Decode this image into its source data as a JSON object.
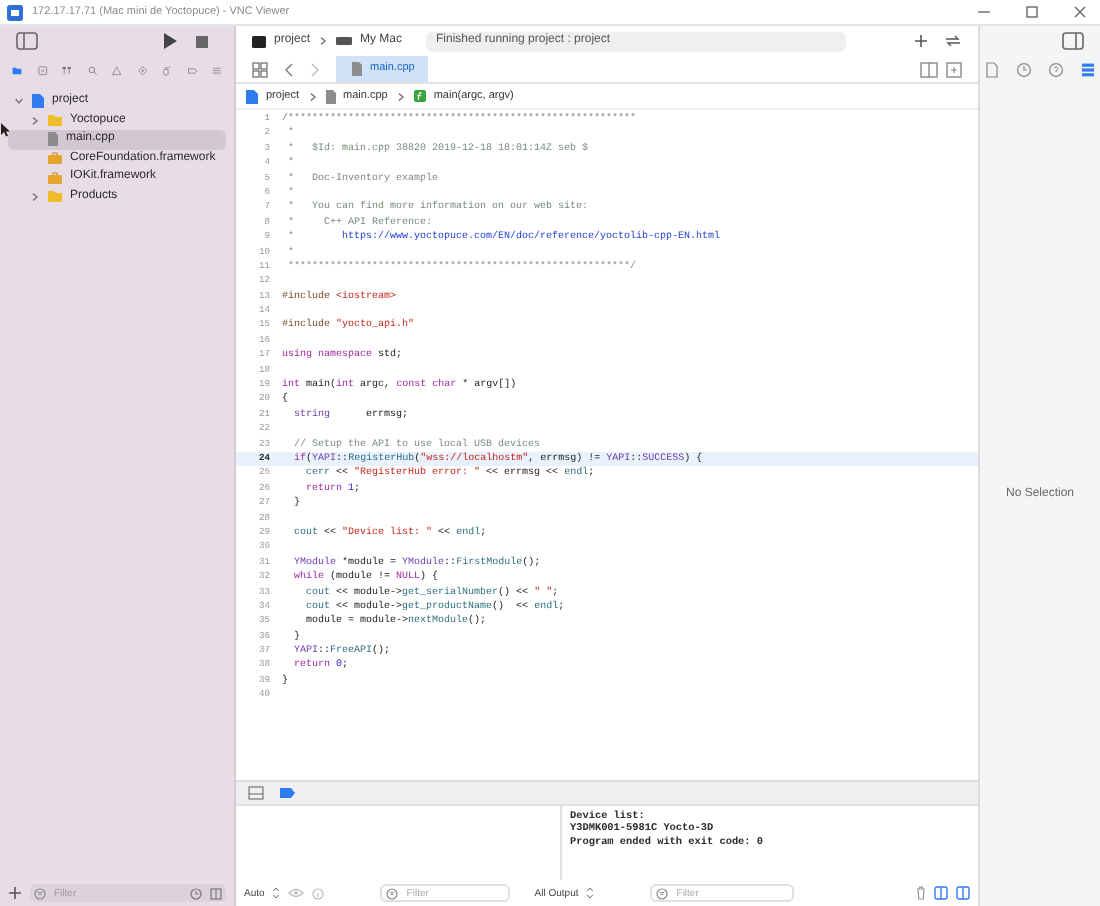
{
  "window": {
    "title": "172.17.17.71 (Mac mini de Yoctopuce) - VNC Viewer"
  },
  "toolbar": {
    "scheme": "project",
    "destination": "My Mac",
    "status": "Finished running project : project"
  },
  "navigator": {
    "tabs": [
      {
        "kind": "files",
        "selected": true
      },
      {
        "kind": "source-control",
        "selected": false
      },
      {
        "kind": "symbols",
        "selected": false
      },
      {
        "kind": "find",
        "selected": false
      },
      {
        "kind": "issues",
        "selected": false
      },
      {
        "kind": "tests",
        "selected": false
      },
      {
        "kind": "debug",
        "selected": false
      },
      {
        "kind": "breakpoints",
        "selected": false
      },
      {
        "kind": "reports",
        "selected": false
      }
    ],
    "tree": [
      {
        "label": "project",
        "kind": "project",
        "expanded": true,
        "selected": false,
        "children": [
          {
            "label": "Yoctopuce",
            "kind": "folder",
            "expanded": false,
            "selected": false
          },
          {
            "label": "main.cpp",
            "kind": "file",
            "selected": true
          },
          {
            "label": "CoreFoundation.framework",
            "kind": "framework",
            "selected": false
          },
          {
            "label": "IOKit.framework",
            "kind": "framework",
            "selected": false
          },
          {
            "label": "Products",
            "kind": "folder",
            "expanded": false,
            "selected": false
          }
        ]
      }
    ],
    "filter_placeholder": "Filter"
  },
  "editor": {
    "tabs": [
      {
        "label": "main.cpp",
        "selected": true
      }
    ],
    "breadcrumb": [
      {
        "label": "project",
        "kind": "project"
      },
      {
        "label": "main.cpp",
        "kind": "file"
      },
      {
        "label": "main(argc, argv)",
        "kind": "function"
      }
    ],
    "lines": [
      {
        "number": "1",
        "current": false,
        "segments": [
          {
            "text": "/**********************************************************",
            "kind": "comment"
          }
        ]
      },
      {
        "number": "2",
        "current": false,
        "segments": [
          {
            "text": " *",
            "kind": "comment"
          }
        ]
      },
      {
        "number": "3",
        "current": false,
        "segments": [
          {
            "text": " *   $Id: main.cpp 38820 2019-12-18 18:01:14Z seb $",
            "kind": "comment"
          }
        ]
      },
      {
        "number": "4",
        "current": false,
        "segments": [
          {
            "text": " *",
            "kind": "comment"
          }
        ]
      },
      {
        "number": "5",
        "current": false,
        "segments": [
          {
            "text": " *   Doc-Inventory example",
            "kind": "comment"
          }
        ]
      },
      {
        "number": "6",
        "current": false,
        "segments": [
          {
            "text": " *",
            "kind": "comment"
          }
        ]
      },
      {
        "number": "7",
        "current": false,
        "segments": [
          {
            "text": " *   You can find more information on our web site:",
            "kind": "comment"
          }
        ]
      },
      {
        "number": "8",
        "current": false,
        "segments": [
          {
            "text": " *     C++ API Reference:",
            "kind": "comment"
          }
        ]
      },
      {
        "number": "9",
        "current": false,
        "segments": [
          {
            "text": " *        ",
            "kind": "comment"
          },
          {
            "text": "https://www.yoctopuce.com/EN/doc/reference/yoctolib-cpp-EN.html",
            "kind": "url"
          }
        ]
      },
      {
        "number": "10",
        "current": false,
        "segments": [
          {
            "text": " *",
            "kind": "comment"
          }
        ]
      },
      {
        "number": "11",
        "current": false,
        "segments": [
          {
            "text": " *********************************************************/",
            "kind": "comment"
          }
        ]
      },
      {
        "number": "12",
        "current": false
      },
      {
        "number": "13",
        "current": false,
        "segments": [
          {
            "text": "#include ",
            "kind": "preproc"
          },
          {
            "text": "<iostream>",
            "kind": "string"
          }
        ]
      },
      {
        "number": "14",
        "current": false
      },
      {
        "number": "15",
        "current": false,
        "segments": [
          {
            "text": "#include ",
            "kind": "preproc"
          },
          {
            "text": "\"yocto_api.h\"",
            "kind": "string"
          }
        ]
      },
      {
        "number": "16",
        "current": false
      },
      {
        "number": "17",
        "current": false,
        "segments": [
          {
            "text": "using namespace",
            "kind": "keyword"
          },
          {
            "text": " std;",
            "kind": "plain"
          }
        ]
      },
      {
        "number": "18",
        "current": false
      },
      {
        "number": "19",
        "current": false,
        "segments": [
          {
            "text": "int",
            "kind": "keyword"
          },
          {
            "text": " main(",
            "kind": "plain"
          },
          {
            "text": "int",
            "kind": "keyword"
          },
          {
            "text": " argc, ",
            "kind": "plain"
          },
          {
            "text": "const char",
            "kind": "keyword"
          },
          {
            "text": " * argv[])",
            "kind": "plain"
          }
        ]
      },
      {
        "number": "20",
        "current": false,
        "segments": [
          {
            "text": "{",
            "kind": "plain"
          }
        ]
      },
      {
        "number": "21",
        "current": false,
        "segments": [
          {
            "text": "  string",
            "kind": "type"
          },
          {
            "text": "      errmsg;",
            "kind": "plain"
          }
        ]
      },
      {
        "number": "22",
        "current": false
      },
      {
        "number": "23",
        "current": false,
        "segments": [
          {
            "text": "  // Setup the API to use local USB devices",
            "kind": "comment"
          }
        ]
      },
      {
        "number": "24",
        "current": true,
        "segments": [
          {
            "text": "  if",
            "kind": "keyword"
          },
          {
            "text": "(",
            "kind": "plain"
          },
          {
            "text": "YAPI",
            "kind": "type"
          },
          {
            "text": "::",
            "kind": "plain"
          },
          {
            "text": "RegisterHub",
            "kind": "call"
          },
          {
            "text": "(",
            "kind": "plain"
          },
          {
            "text": "\"wss://localhostm\"",
            "kind": "string"
          },
          {
            "text": ", errmsg) != ",
            "kind": "plain"
          },
          {
            "text": "YAPI",
            "kind": "type"
          },
          {
            "text": "::",
            "kind": "plain"
          },
          {
            "text": "SUCCESS",
            "kind": "type"
          },
          {
            "text": ") {",
            "kind": "plain"
          }
        ]
      },
      {
        "number": "25",
        "current": false,
        "segments": [
          {
            "text": "    cerr",
            "kind": "call"
          },
          {
            "text": " << ",
            "kind": "plain"
          },
          {
            "text": "\"RegisterHub error: \"",
            "kind": "string"
          },
          {
            "text": " << errmsg << ",
            "kind": "plain"
          },
          {
            "text": "endl",
            "kind": "call"
          },
          {
            "text": ";",
            "kind": "plain"
          }
        ]
      },
      {
        "number": "26",
        "current": false,
        "segments": [
          {
            "text": "    return ",
            "kind": "keyword"
          },
          {
            "text": "1",
            "kind": "number"
          },
          {
            "text": ";",
            "kind": "plain"
          }
        ]
      },
      {
        "number": "27",
        "current": false,
        "segments": [
          {
            "text": "  }",
            "kind": "plain"
          }
        ]
      },
      {
        "number": "28",
        "current": false
      },
      {
        "number": "29",
        "current": false,
        "segments": [
          {
            "text": "  cout",
            "kind": "call"
          },
          {
            "text": " << ",
            "kind": "plain"
          },
          {
            "text": "\"Device list: \"",
            "kind": "string"
          },
          {
            "text": " << ",
            "kind": "plain"
          },
          {
            "text": "endl",
            "kind": "call"
          },
          {
            "text": ";",
            "kind": "plain"
          }
        ]
      },
      {
        "number": "30",
        "current": false
      },
      {
        "number": "31",
        "current": false,
        "segments": [
          {
            "text": "  YModule",
            "kind": "type"
          },
          {
            "text": " *module = ",
            "kind": "plain"
          },
          {
            "text": "YModule",
            "kind": "type"
          },
          {
            "text": "::",
            "kind": "plain"
          },
          {
            "text": "FirstModule",
            "kind": "call"
          },
          {
            "text": "();",
            "kind": "plain"
          }
        ]
      },
      {
        "number": "32",
        "current": false,
        "segments": [
          {
            "text": "  while",
            "kind": "keyword"
          },
          {
            "text": " (module != ",
            "kind": "plain"
          },
          {
            "text": "NULL",
            "kind": "keyword"
          },
          {
            "text": ") {",
            "kind": "plain"
          }
        ]
      },
      {
        "number": "33",
        "current": false,
        "segments": [
          {
            "text": "    cout",
            "kind": "call"
          },
          {
            "text": " << module->",
            "kind": "plain"
          },
          {
            "text": "get_serialNumber",
            "kind": "call"
          },
          {
            "text": "() << ",
            "kind": "plain"
          },
          {
            "text": "\" \"",
            "kind": "string"
          },
          {
            "text": ";",
            "kind": "plain"
          }
        ]
      },
      {
        "number": "34",
        "current": false,
        "segments": [
          {
            "text": "    cout",
            "kind": "call"
          },
          {
            "text": " << module->",
            "kind": "plain"
          },
          {
            "text": "get_productName",
            "kind": "call"
          },
          {
            "text": "()  << ",
            "kind": "plain"
          },
          {
            "text": "endl",
            "kind": "call"
          },
          {
            "text": ";",
            "kind": "plain"
          }
        ]
      },
      {
        "number": "35",
        "current": false,
        "segments": [
          {
            "text": "    module = module->",
            "kind": "plain"
          },
          {
            "text": "nextModule",
            "kind": "call"
          },
          {
            "text": "();",
            "kind": "plain"
          }
        ]
      },
      {
        "number": "36",
        "current": false,
        "segments": [
          {
            "text": "  }",
            "kind": "plain"
          }
        ]
      },
      {
        "number": "37",
        "current": false,
        "segments": [
          {
            "text": "  YAPI",
            "kind": "type"
          },
          {
            "text": "::",
            "kind": "plain"
          },
          {
            "text": "FreeAPI",
            "kind": "call"
          },
          {
            "text": "();",
            "kind": "plain"
          }
        ]
      },
      {
        "number": "38",
        "current": false,
        "segments": [
          {
            "text": "  return ",
            "kind": "keyword"
          },
          {
            "text": "0",
            "kind": "number"
          },
          {
            "text": ";",
            "kind": "plain"
          }
        ]
      },
      {
        "number": "39",
        "current": false,
        "segments": [
          {
            "text": "}",
            "kind": "plain"
          }
        ]
      },
      {
        "number": "40",
        "current": false
      }
    ]
  },
  "debug": {
    "console": [
      "Device list:",
      "Y3DMK001-5981C Yocto-3D",
      "Program ended with exit code: 0"
    ],
    "variables_mode": "Auto",
    "output_mode": "All Output",
    "variables_filter": "Filter",
    "output_filter": "Filter"
  },
  "inspector": {
    "tabs": [
      {
        "kind": "file",
        "selected": false
      },
      {
        "kind": "history",
        "selected": false
      },
      {
        "kind": "help",
        "selected": false
      },
      {
        "kind": "attributes",
        "selected": true
      }
    ],
    "empty_text": "No Selection"
  }
}
